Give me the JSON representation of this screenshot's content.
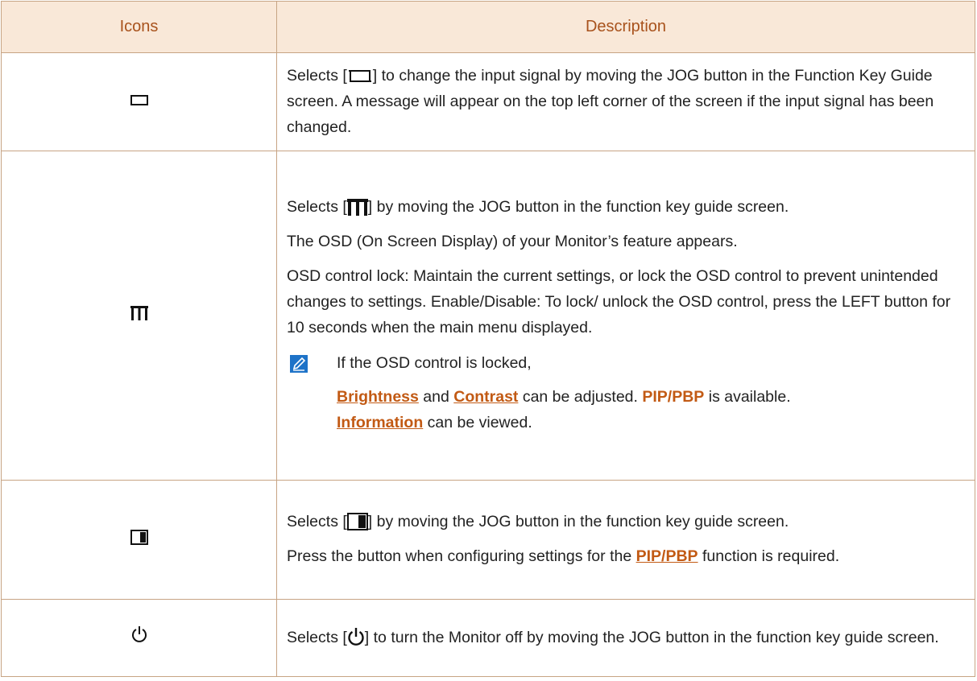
{
  "table": {
    "headers": {
      "icons": "Icons",
      "description": "Description"
    },
    "rows": [
      {
        "icon": "source-icon",
        "sel_prefix": "Selects [",
        "sel_suffix": "] to change the input signal by moving the JOG button in the Function Key Guide screen. A message will appear on the top left corner of the screen if the input signal has been changed."
      },
      {
        "icon": "menu-icon",
        "sel_prefix": "Selects [",
        "sel_suffix": "] by moving the JOG button in the function key guide screen.",
        "p2": "The OSD (On Screen Display) of your Monitor’s feature appears.",
        "p3": "OSD control lock: Maintain the current settings, or lock the OSD control to prevent unintended changes to settings. Enable/Disable: To lock/ unlock the OSD control, press the LEFT button for 10 seconds when the main menu displayed.",
        "note": {
          "icon": "note-pencil-icon",
          "line1": "If the OSD control is locked,",
          "brightness": "Brightness",
          "and": " and ",
          "contrast": "Contrast",
          "adjusted": " can be adjusted. ",
          "pip": "PIP/PBP",
          "available": " is available.",
          "information": "Information",
          "viewed": " can be viewed."
        }
      },
      {
        "icon": "pip-icon",
        "sel_prefix": "Selects [",
        "sel_suffix": "] by moving the JOG button in the function key guide screen.",
        "p2_prefix": "Press the button when configuring settings for the ",
        "p2_link": "PIP/PBP",
        "p2_suffix": " function is required."
      },
      {
        "icon": "power-icon",
        "sel_prefix": "Selects [",
        "sel_suffix": "] to turn the Monitor off by moving the JOG button in the function key guide screen."
      }
    ]
  },
  "colors": {
    "header_bg": "#f9e8d8",
    "header_text": "#a8521c",
    "border": "#c7a484",
    "link": "#c25a14",
    "note_icon": "#1e73c8"
  }
}
